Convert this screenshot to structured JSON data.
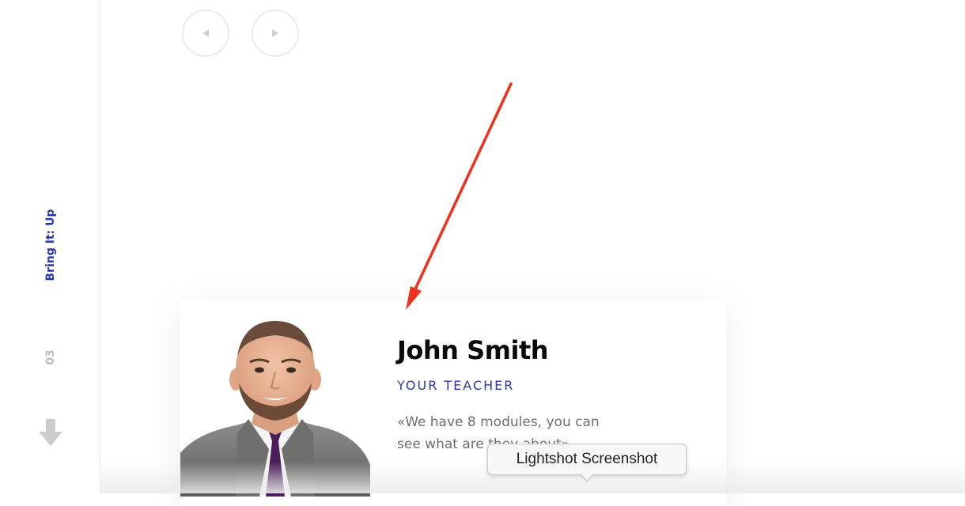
{
  "rail": {
    "section_title": "Bring It: Up",
    "section_number": "03",
    "scroll_icon": "down-arrow-icon"
  },
  "slider_nav": {
    "prev_icon": "triangle-left-icon",
    "next_icon": "triangle-right-icon"
  },
  "card": {
    "name": "John Smith",
    "role": "YOUR TEACHER",
    "quote": "«We have 8 modules, you can see what are they about»"
  },
  "tooltip": {
    "text": "Lightshot Screenshot"
  },
  "colors": {
    "accent": "#2b39a8",
    "annotation": "#f0301c"
  }
}
